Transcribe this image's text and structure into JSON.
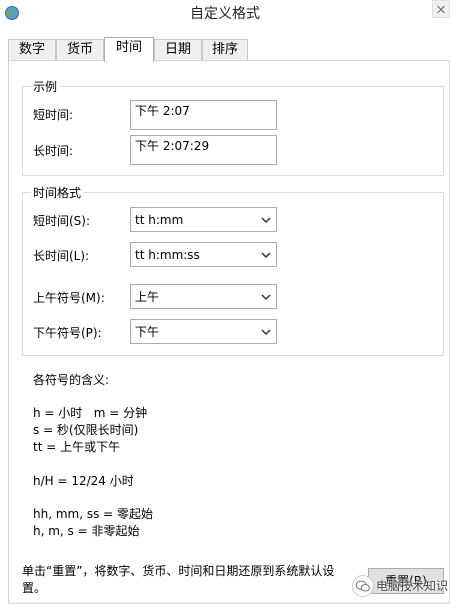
{
  "window": {
    "title": "自定义格式"
  },
  "tabs": [
    {
      "label": "数字"
    },
    {
      "label": "货币"
    },
    {
      "label": "时间",
      "active": true
    },
    {
      "label": "日期"
    },
    {
      "label": "排序"
    }
  ],
  "example": {
    "title": "示例",
    "short_label": "短时间:",
    "short_value": "下午 2:07",
    "long_label": "长时间:",
    "long_value": "下午 2:07:29"
  },
  "time_format": {
    "title": "时间格式",
    "short_label": "短时间(S):",
    "short_value": "tt h:mm",
    "long_label": "长时间(L):",
    "long_value": "tt h:mm:ss",
    "am_label": "上午符号(M):",
    "am_value": "上午",
    "pm_label": "下午符号(P):",
    "pm_value": "下午"
  },
  "symbols": {
    "heading": "各符号的含义:",
    "lines": [
      "h = 小时   m = 分钟",
      "s = 秒(仅限长时间)",
      "tt = 上午或下午",
      "h/H = 12/24 小时",
      "hh, mm, ss = 零起始",
      "h, m, s = 非零起始"
    ]
  },
  "footer": {
    "text": "单击“重置”，将数字、货币、时间和日期还原到系统默认设置。",
    "reset_label": "重置(R)"
  },
  "watermark": {
    "text": "电脑技术知识"
  }
}
